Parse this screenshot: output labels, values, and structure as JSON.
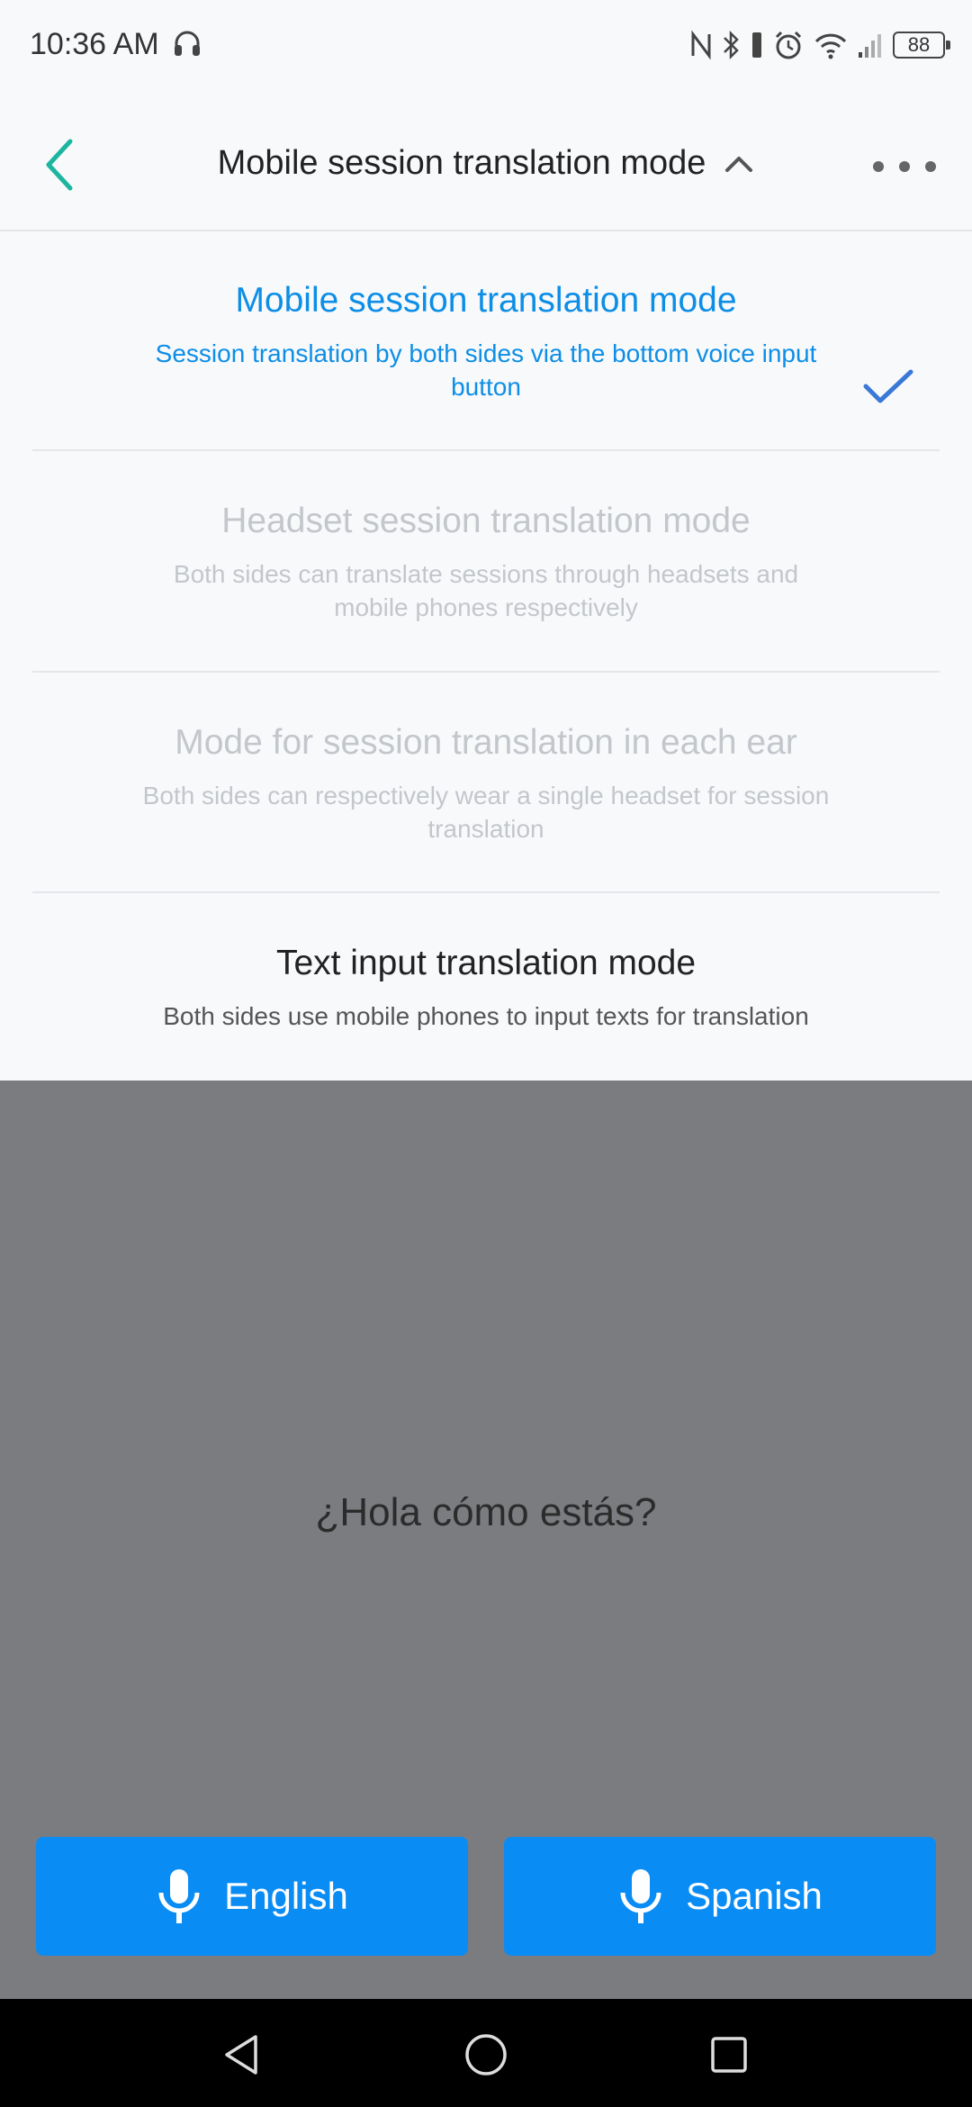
{
  "status_bar": {
    "time": "10:36 AM",
    "battery": "88",
    "icons": [
      "headset-icon",
      "nfc-icon",
      "bluetooth-icon",
      "alarm-icon",
      "wifi-icon",
      "signal-icon",
      "battery-icon"
    ]
  },
  "header": {
    "title": "Mobile session translation mode",
    "back_icon": "chevron-left-icon",
    "expand_icon": "chevron-up-icon",
    "more_icon": "more-dots-icon"
  },
  "modes": [
    {
      "title": "Mobile session translation mode",
      "description": "Session translation by both sides via the bottom voice input button",
      "state": "selected"
    },
    {
      "title": "Headset session translation mode",
      "description": "Both sides can translate sessions through headsets and mobile phones respectively",
      "state": "disabled"
    },
    {
      "title": "Mode for session translation in each ear",
      "description": "Both sides can respectively wear a single headset for session translation",
      "state": "disabled"
    },
    {
      "title": "Text input translation mode",
      "description": "Both sides use mobile phones to input texts for translation",
      "state": "enabled"
    }
  ],
  "conversation": {
    "phrase": "¿Hola cómo estás?"
  },
  "voice_buttons": {
    "left_label": "English",
    "right_label": "Spanish"
  },
  "colors": {
    "accent": "#0d8ee6",
    "button": "#0a8cf5",
    "back_arrow": "#1bb5a0",
    "overlay": "#7b7c80"
  }
}
